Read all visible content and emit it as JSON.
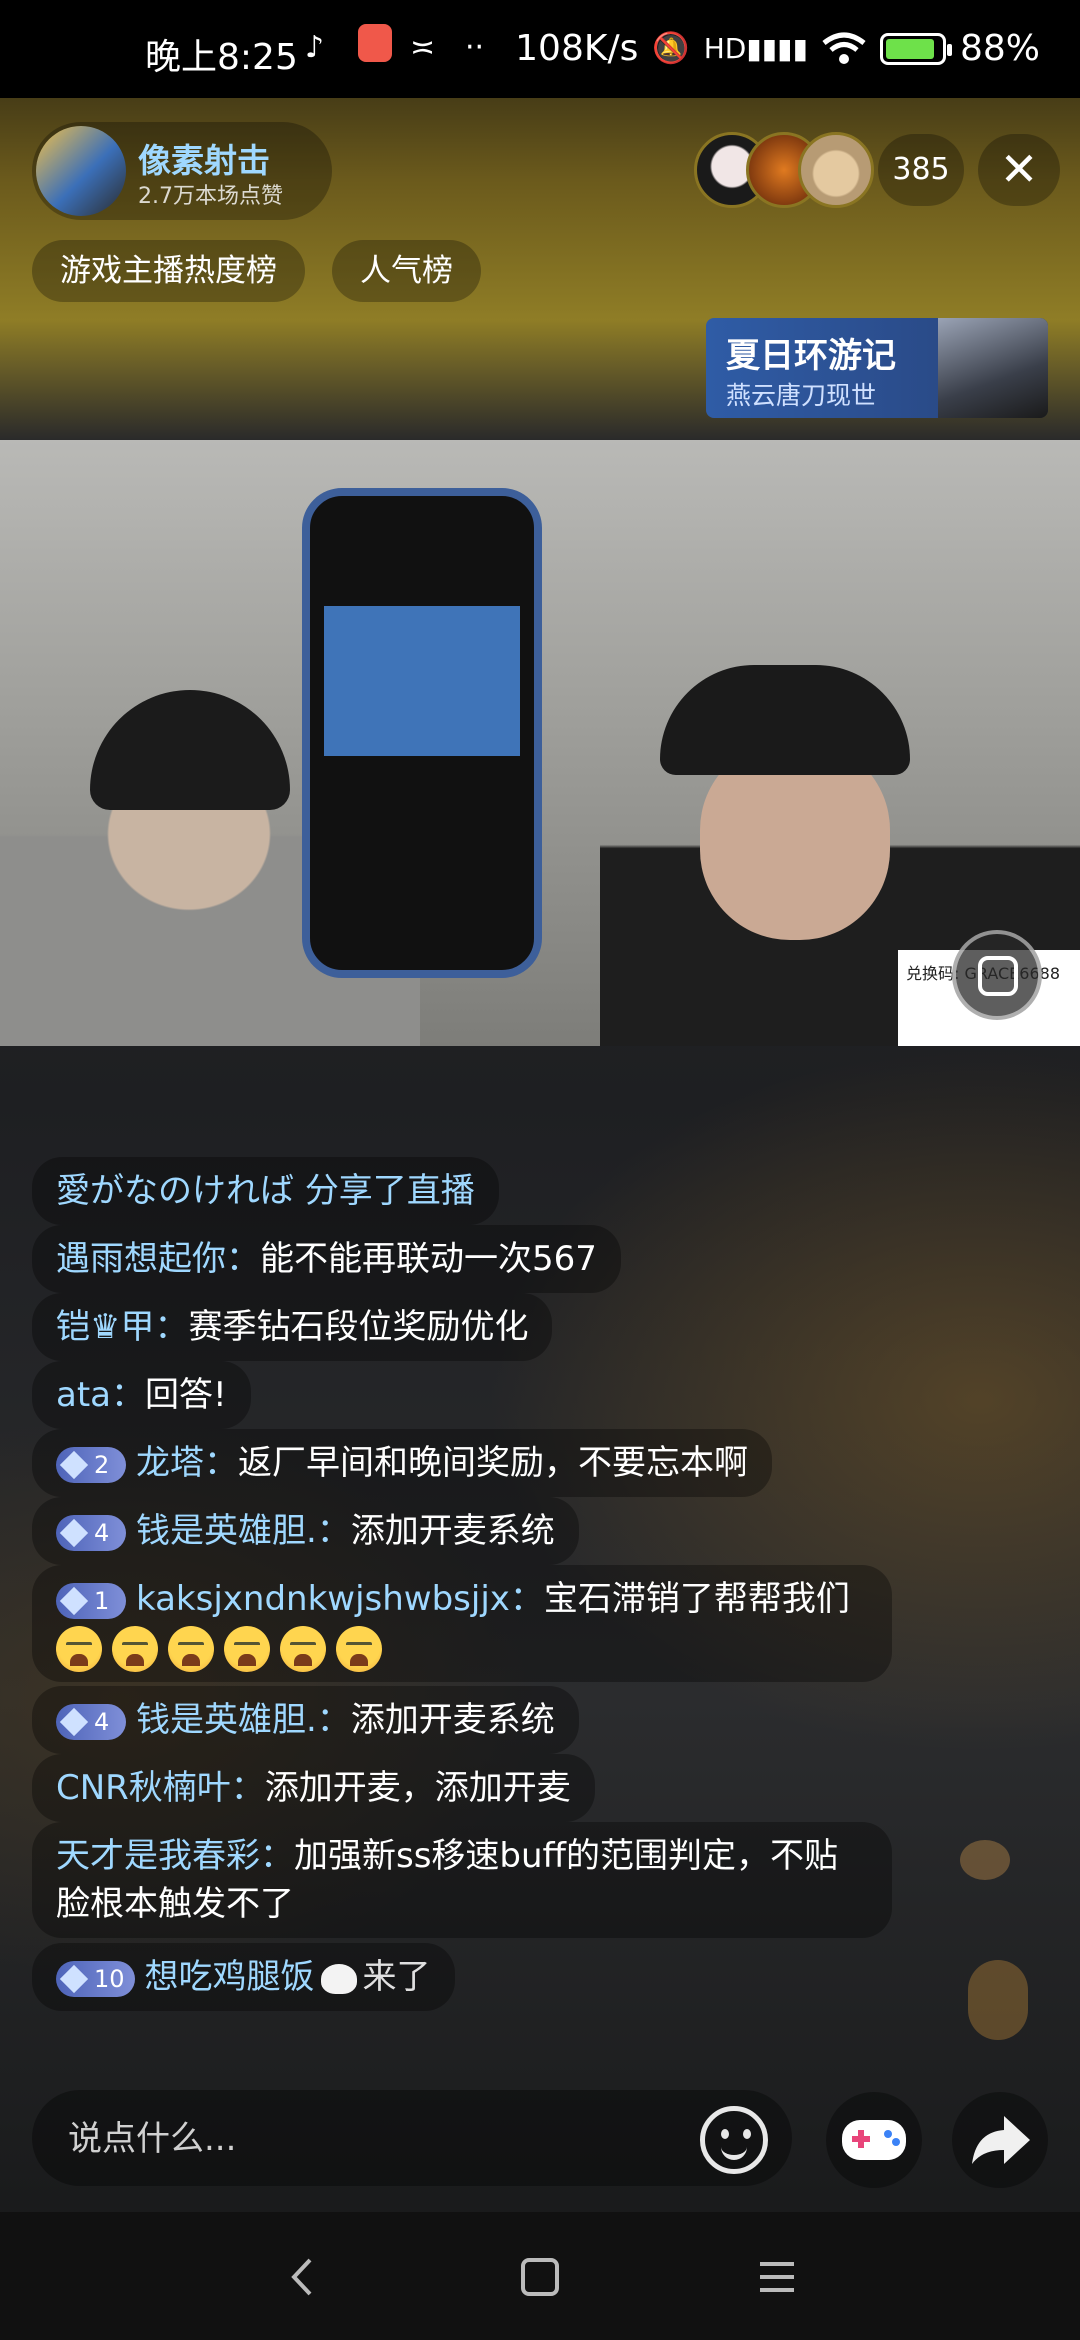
{
  "status_bar": {
    "time": "晚上8:25",
    "speed": "108K/s",
    "battery": "88%",
    "battery_level": 0.88,
    "icons": [
      "tiktok-icon",
      "app-notification-icon",
      "link-icon",
      "more-dots-icon",
      "mute-icon",
      "hd-signal-icon",
      "wifi-icon",
      "battery-charging-icon"
    ]
  },
  "host": {
    "name": "像素射击",
    "likes": "2.7万本场点赞"
  },
  "viewers": {
    "count": "385"
  },
  "pills": {
    "hot_rank": "游戏主播热度榜",
    "popularity": "人气榜"
  },
  "banner": {
    "title": "夏日环游记",
    "subtitle": "燕云唐刀现世"
  },
  "video_overlay": {
    "code_text": "兑换码: GRACE6688"
  },
  "chat": [
    {
      "name": "愛がなのければ",
      "text": "分享了直播",
      "badge": "",
      "name_color": "#9fd8ff"
    },
    {
      "name": "遇雨想起你：",
      "text": "能不能再联动一次567",
      "badge": ""
    },
    {
      "name": "铠♛甲：",
      "text": "赛季钻石段位奖励优化",
      "badge": ""
    },
    {
      "name": "ata：",
      "text": "回答!",
      "badge": ""
    },
    {
      "name": "龙塔：",
      "text": "返厂早间和晚间奖励，不要忘本啊",
      "badge": "2"
    },
    {
      "name": "钱是英雄胆.：",
      "text": "添加开麦系统",
      "badge": "4"
    },
    {
      "name": "kaksjxndnkwjshwbsjjx：",
      "text": "宝石滞销了帮帮我们",
      "badge": "1",
      "emoji_count": 6
    },
    {
      "name": "钱是英雄胆.：",
      "text": "添加开麦系统",
      "badge": "4"
    },
    {
      "name": "CNR秋楠叶：",
      "text": "添加开麦，添加开麦",
      "badge": ""
    },
    {
      "name": "天才是我春彩：",
      "text": "加强新ss移速buff的范围判定，不贴脸根本触发不了",
      "badge": ""
    },
    {
      "name": "想吃鸡腿饭",
      "text": "来了",
      "badge": "10"
    }
  ],
  "input": {
    "placeholder": "说点什么..."
  },
  "nav": {
    "icons": [
      "back-icon",
      "home-icon",
      "menu-icon"
    ]
  },
  "colors": {
    "chat_name": "#9fd8ff",
    "badge": "#6f80cf",
    "banner": "#2f5ca6",
    "battery": "#6ee14a"
  }
}
